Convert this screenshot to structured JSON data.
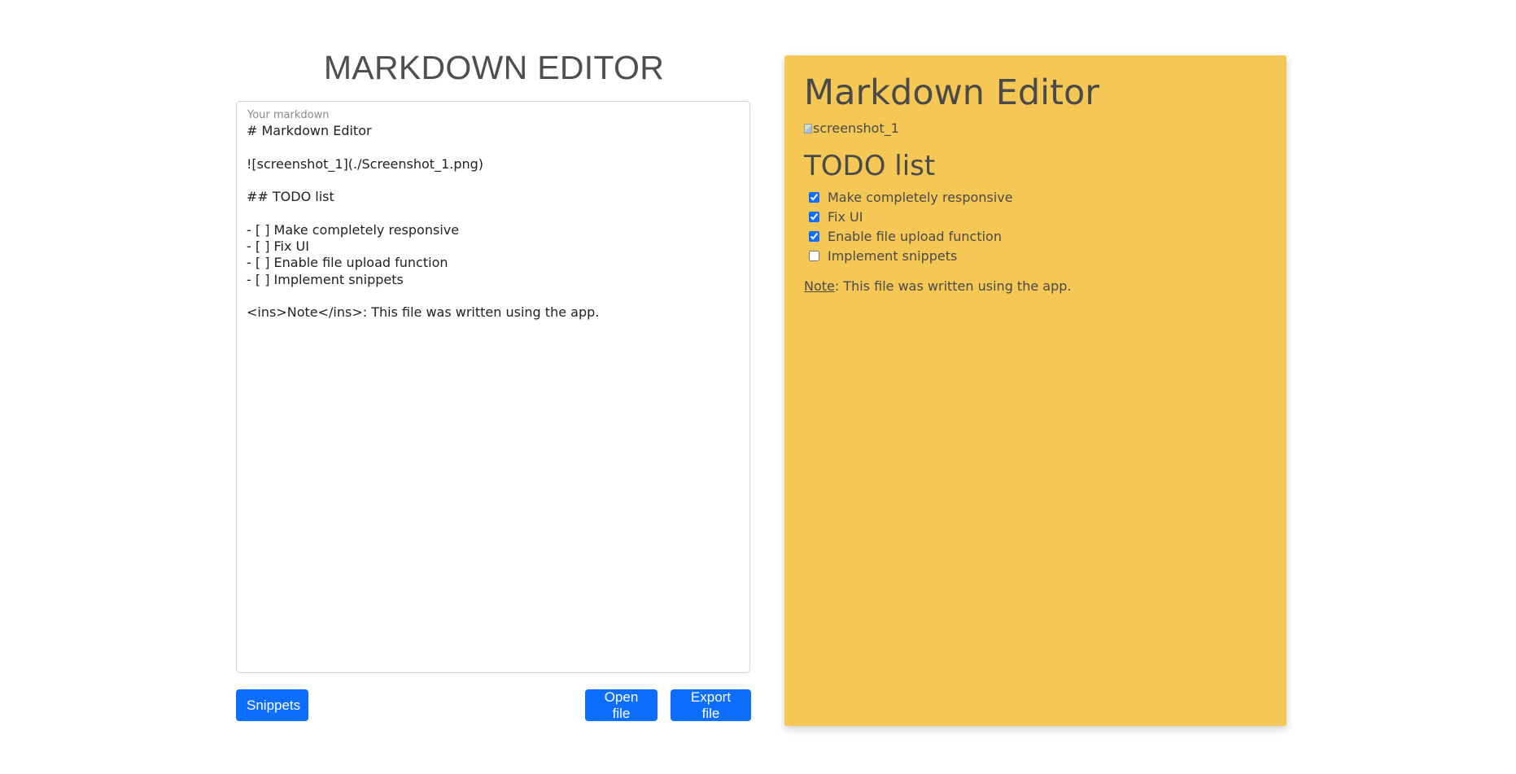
{
  "editor": {
    "title": "MARKDOWN EDITOR",
    "label": "Your markdown",
    "content": "# Markdown Editor\n\n![screenshot_1](./Screenshot_1.png)\n\n## TODO list\n\n- [ ] Make completely responsive\n- [ ] Fix UI\n- [ ] Enable file upload function\n- [ ] Implement snippets\n\n<ins>Note</ins>: This file was written using the app.",
    "buttons": {
      "snippets": "Snippets",
      "open": "Open file",
      "export": "Export file"
    }
  },
  "preview": {
    "h1": "Markdown Editor",
    "image_alt": "screenshot_1",
    "h2": "TODO list",
    "todos": [
      {
        "label": "Make completely responsive",
        "checked": true
      },
      {
        "label": "Fix UI",
        "checked": true
      },
      {
        "label": "Enable file upload function",
        "checked": true
      },
      {
        "label": "Implement snippets",
        "checked": false
      }
    ],
    "note_word": "Note",
    "note_rest": ": This file was written using the app."
  },
  "colors": {
    "preview_bg": "#f5c755",
    "button_bg": "#0d6efd",
    "title_text": "#4f4f4f"
  }
}
